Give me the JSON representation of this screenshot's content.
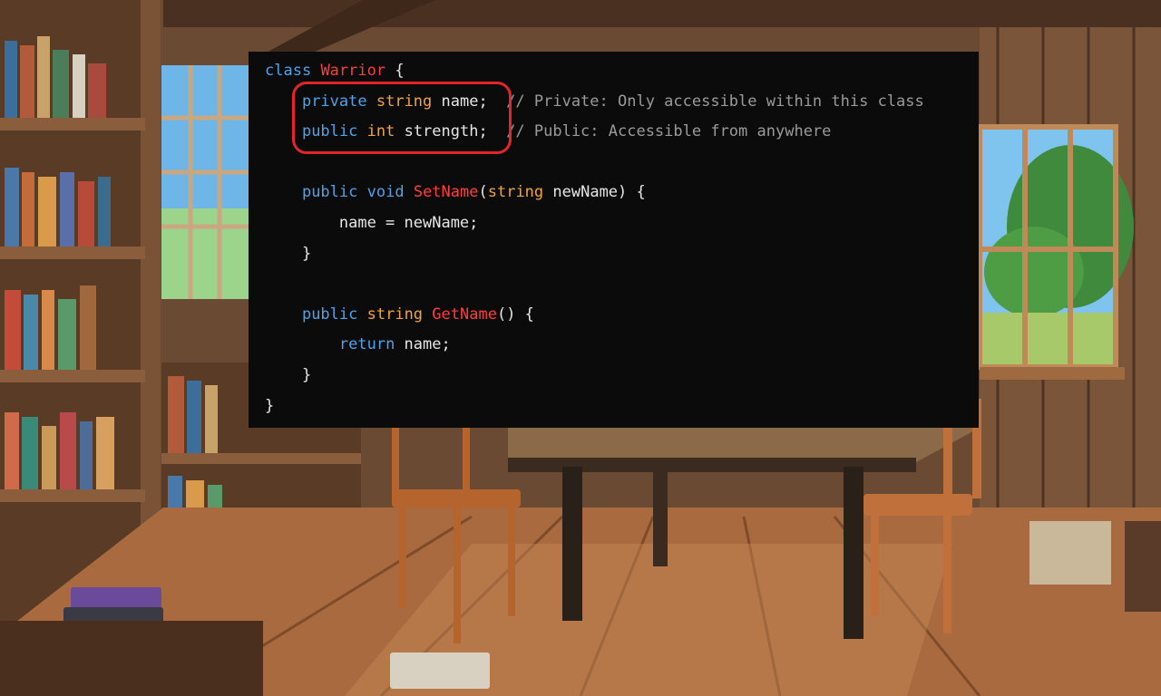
{
  "colors": {
    "panel_bg": "#0b0b0c",
    "keyword_blue": "#4ea3e8",
    "type_orange": "#f0a43a",
    "name_red": "#ff3d3d",
    "comment_gray": "#9a9a9a",
    "text": "#e6e6e6",
    "highlight_ring": "#e3252b"
  },
  "code": {
    "lines": [
      {
        "tokens": [
          {
            "t": "class",
            "c": "kw-blue"
          },
          {
            "t": " ",
            "c": "plain"
          },
          {
            "t": "Warrior",
            "c": "cls-red"
          },
          {
            "t": " {",
            "c": "plain"
          }
        ]
      },
      {
        "tokens": [
          {
            "t": "    ",
            "c": "plain"
          },
          {
            "t": "private",
            "c": "kw-blue"
          },
          {
            "t": " ",
            "c": "plain"
          },
          {
            "t": "string",
            "c": "kw-orange"
          },
          {
            "t": " name;",
            "c": "plain"
          },
          {
            "t": "  // Private: Only accessible within this class",
            "c": "comment"
          }
        ]
      },
      {
        "tokens": [
          {
            "t": "    ",
            "c": "plain"
          },
          {
            "t": "public",
            "c": "kw-blue"
          },
          {
            "t": " ",
            "c": "plain"
          },
          {
            "t": "int",
            "c": "kw-orange"
          },
          {
            "t": " strength;",
            "c": "plain"
          },
          {
            "t": "  // Public: Accessible from anywhere",
            "c": "comment"
          }
        ]
      },
      {
        "tokens": []
      },
      {
        "tokens": [
          {
            "t": "    ",
            "c": "plain"
          },
          {
            "t": "public",
            "c": "kw-blue"
          },
          {
            "t": " ",
            "c": "plain"
          },
          {
            "t": "void",
            "c": "kw-blue"
          },
          {
            "t": " ",
            "c": "plain"
          },
          {
            "t": "SetName",
            "c": "cls-red"
          },
          {
            "t": "(",
            "c": "plain"
          },
          {
            "t": "string",
            "c": "kw-orange"
          },
          {
            "t": " newName) {",
            "c": "plain"
          }
        ]
      },
      {
        "tokens": [
          {
            "t": "        name = newName;",
            "c": "plain"
          }
        ]
      },
      {
        "tokens": [
          {
            "t": "    }",
            "c": "plain"
          }
        ]
      },
      {
        "tokens": []
      },
      {
        "tokens": [
          {
            "t": "    ",
            "c": "plain"
          },
          {
            "t": "public",
            "c": "kw-blue"
          },
          {
            "t": " ",
            "c": "plain"
          },
          {
            "t": "string",
            "c": "kw-orange"
          },
          {
            "t": " ",
            "c": "plain"
          },
          {
            "t": "GetName",
            "c": "cls-red"
          },
          {
            "t": "() {",
            "c": "plain"
          }
        ]
      },
      {
        "tokens": [
          {
            "t": "        ",
            "c": "plain"
          },
          {
            "t": "return",
            "c": "kw-blue"
          },
          {
            "t": " name;",
            "c": "plain"
          }
        ]
      },
      {
        "tokens": [
          {
            "t": "    }",
            "c": "plain"
          }
        ]
      },
      {
        "tokens": [
          {
            "t": "}",
            "c": "plain"
          }
        ]
      }
    ]
  }
}
